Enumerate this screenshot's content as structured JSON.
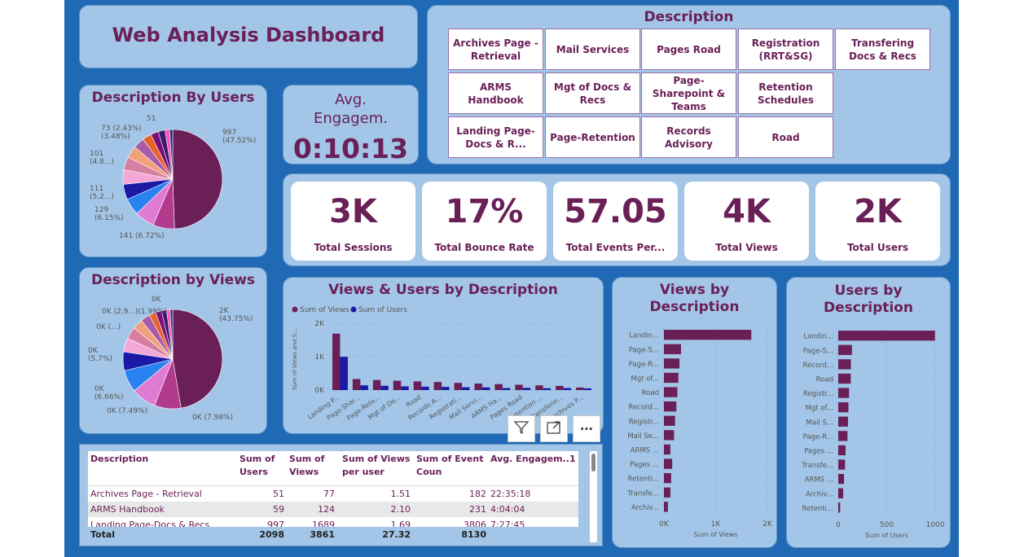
{
  "header": {
    "title": "Web Analysis Dashboard"
  },
  "description_slicer": {
    "title": "Description",
    "items": [
      "Archives Page - Retrieval",
      "Mail Services",
      "Pages Road",
      "Registration (RRT&SG)",
      "Transfering Docs & Recs",
      "ARMS Handbook",
      "Mgt of Docs & Recs",
      "Page-Sharepoint & Teams",
      "Retention Schedules",
      "Landing Page-Docs & R...",
      "Page-Retention",
      "Records Advisory",
      "Road"
    ]
  },
  "avg_engagement": {
    "title": "Avg. Engagem.",
    "value": "0:10:13"
  },
  "kpis": [
    {
      "value": "3K",
      "label": "Total Sessions"
    },
    {
      "value": "17%",
      "label": "Total Bounce Rate"
    },
    {
      "value": "57.05",
      "label": "Total Events Per..."
    },
    {
      "value": "4K",
      "label": "Total Views"
    },
    {
      "value": "2K",
      "label": "Total Users"
    }
  ],
  "pie_users": {
    "title": "Description By Users",
    "labels": [
      {
        "text": "997\n(47.52%)"
      },
      {
        "text": "141 (6.72%)"
      },
      {
        "text": "129\n(6.15%)"
      },
      {
        "text": "111\n(5.2...)"
      },
      {
        "text": "101\n(4.8...)"
      },
      {
        "text": "73 (2.43%)\n(3.48%)"
      },
      {
        "text": "51"
      }
    ]
  },
  "pie_views": {
    "title": "Description by Views",
    "labels": [
      {
        "text": "2K\n(43.75%)"
      },
      {
        "text": "0K (7.98%)"
      },
      {
        "text": "0K (7.49%)"
      },
      {
        "text": "0K\n(6.66%)"
      },
      {
        "text": "0K\n(5.7%)"
      },
      {
        "text": "0K (...)"
      },
      {
        "text": "0K (2.9...)(1.99%)"
      },
      {
        "text": "0K"
      }
    ]
  },
  "colors": {
    "primary": "#6a1f57",
    "secondary": "#1a1aa6",
    "background": "#2069b4",
    "card": "#a3c6e8"
  },
  "chart_data": [
    {
      "type": "bar",
      "title": "Views & Users by Description",
      "ylabel": "Sum of Views and S...",
      "legend": [
        "Sum of Views",
        "Sum of Users"
      ],
      "ylim": [
        0,
        2000
      ],
      "yticks": [
        "0K",
        "1K",
        "2K"
      ],
      "categories": [
        "Landing P...",
        "Page-Shar...",
        "Page-Rete...",
        "Mgt of Do...",
        "Road",
        "Records A...",
        "Registrati...",
        "Mail Servi...",
        "ARMS Ha...",
        "Pages Road",
        "Retention ...",
        "Transferin...",
        "Archives P..."
      ],
      "series": [
        {
          "name": "Sum of Views",
          "values": [
            1689,
            330,
            300,
            280,
            260,
            240,
            215,
            195,
            180,
            160,
            140,
            125,
            77
          ]
        },
        {
          "name": "Sum of Users",
          "values": [
            997,
            141,
            129,
            111,
            101,
            95,
            85,
            80,
            59,
            65,
            55,
            60,
            51
          ]
        }
      ]
    },
    {
      "type": "bar",
      "title": "Views by Description",
      "xlabel": "Sum of Views",
      "xlim": [
        0,
        2000
      ],
      "xticks": [
        "0K",
        "1K",
        "2K"
      ],
      "categories": [
        "Landin...",
        "Page-S...",
        "Page-R...",
        "Mgt of...",
        "Road",
        "Record...",
        "Registr...",
        "Mail Se...",
        "ARMS ...",
        "Pages ...",
        "Retenti...",
        "Transfe...",
        "Archiv..."
      ],
      "values": [
        1689,
        330,
        300,
        280,
        260,
        240,
        215,
        195,
        124,
        160,
        140,
        125,
        77
      ]
    },
    {
      "type": "bar",
      "title": "Users by Description",
      "xlabel": "Sum of Users",
      "xlim": [
        0,
        1000
      ],
      "xticks": [
        "0",
        "500",
        "1000"
      ],
      "categories": [
        "Landin...",
        "Page-S...",
        "Record...",
        "Road",
        "Registr...",
        "Mgt of...",
        "Mail S...",
        "Page-R...",
        "Pages ...",
        "Transfe...",
        "ARMS ...",
        "Archiv...",
        "Retenti..."
      ],
      "values": [
        997,
        141,
        130,
        129,
        111,
        105,
        100,
        95,
        75,
        70,
        59,
        51,
        20
      ]
    }
  ],
  "table": {
    "headers": [
      "Description",
      "Sum of Users",
      "Sum of Views",
      "Sum of Views per user",
      "Sum of Event Coun",
      "Avg. Engagem..1"
    ],
    "rows": [
      [
        "Archives Page - Retrieval",
        "51",
        "77",
        "1.51",
        "182",
        "22:35:18"
      ],
      [
        "ARMS Handbook",
        "59",
        "124",
        "2.10",
        "231",
        "4:04:04"
      ],
      [
        "Landing Page-Docs & Recs",
        "997",
        "1689",
        "1.69",
        "3806",
        "7:27:45"
      ]
    ],
    "total": [
      "Total",
      "2098",
      "3861",
      "27.32",
      "8130",
      ""
    ]
  },
  "toolbar": {
    "filter": "filter-icon",
    "focus": "focus-mode-icon",
    "more": "more-options-icon",
    "more_glyph": "⋯"
  }
}
